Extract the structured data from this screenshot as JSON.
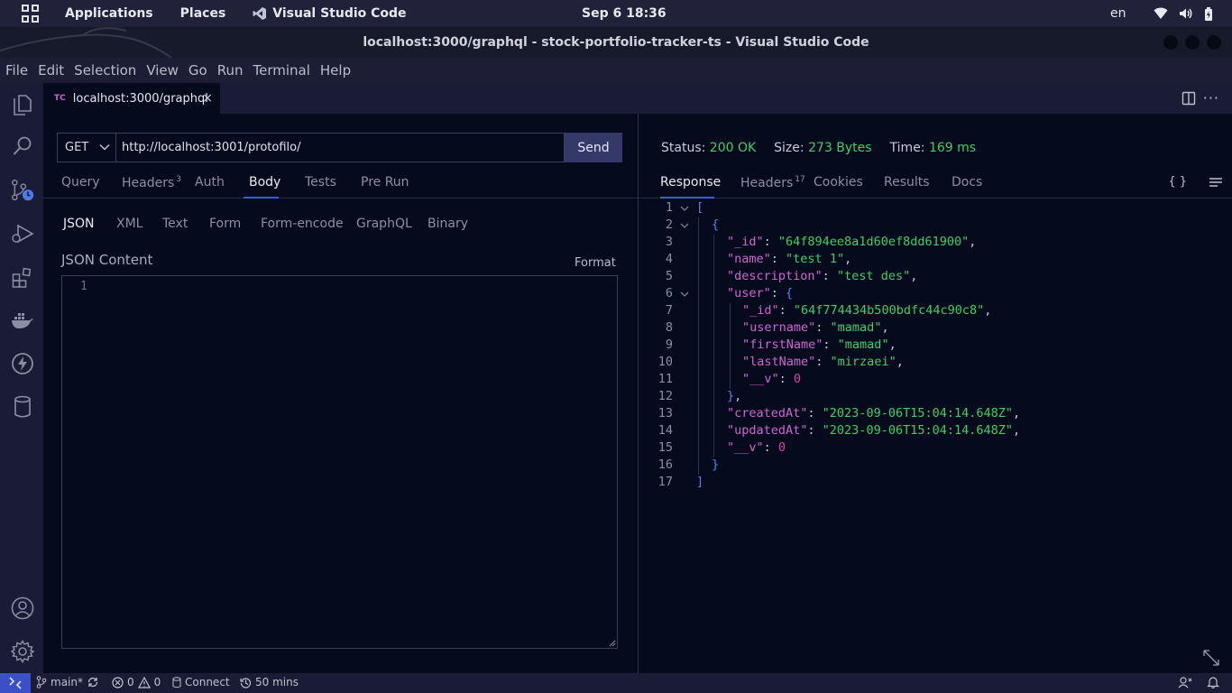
{
  "system_bar": {
    "applications": "Applications",
    "places": "Places",
    "active_app": "Visual Studio Code",
    "clock": "Sep 6  18:36",
    "language": "en"
  },
  "window": {
    "title": "localhost:3000/graphql - stock-portfolio-tracker-ts - Visual Studio Code"
  },
  "menu": [
    "File",
    "Edit",
    "Selection",
    "View",
    "Go",
    "Run",
    "Terminal",
    "Help"
  ],
  "editor_tab": {
    "badge": "TC",
    "label": "localhost:3000/graphql",
    "close": "×"
  },
  "request": {
    "method": "GET",
    "url": "http://localhost:3001/protofilo/",
    "send_label": "Send",
    "tabs": [
      {
        "label": "Query"
      },
      {
        "label": "Headers",
        "count": "3"
      },
      {
        "label": "Auth"
      },
      {
        "label": "Body",
        "active": true
      },
      {
        "label": "Tests"
      },
      {
        "label": "Pre Run"
      }
    ],
    "body_tabs": [
      "JSON",
      "XML",
      "Text",
      "Form",
      "Form-encode",
      "GraphQL",
      "Binary"
    ],
    "json_heading": "JSON Content",
    "format_label": "Format",
    "editor_line_number": "1"
  },
  "response": {
    "status_label": "Status:",
    "status_value": "200 OK",
    "size_label": "Size:",
    "size_value": "273 Bytes",
    "time_label": "Time:",
    "time_value": "169 ms",
    "tabs": [
      {
        "label": "Response",
        "active": true
      },
      {
        "label": "Headers",
        "count": "17"
      },
      {
        "label": "Cookies"
      },
      {
        "label": "Results"
      },
      {
        "label": "Docs"
      }
    ],
    "braces_label": "{ }",
    "body": [
      {
        "n": "1",
        "depth": 0,
        "fold": true,
        "tokens": [
          [
            "br1",
            "["
          ]
        ]
      },
      {
        "n": "2",
        "depth": 1,
        "fold": true,
        "tokens": [
          [
            "br2",
            "{"
          ]
        ]
      },
      {
        "n": "3",
        "depth": 2,
        "tokens": [
          [
            "key",
            "\"_id\""
          ],
          [
            "punc",
            ": "
          ],
          [
            "str",
            "\"64f894ee8a1d60ef8dd61900\""
          ],
          [
            "punc",
            ","
          ]
        ]
      },
      {
        "n": "4",
        "depth": 2,
        "tokens": [
          [
            "key",
            "\"name\""
          ],
          [
            "punc",
            ": "
          ],
          [
            "str",
            "\"test 1\""
          ],
          [
            "punc",
            ","
          ]
        ]
      },
      {
        "n": "5",
        "depth": 2,
        "tokens": [
          [
            "key",
            "\"description\""
          ],
          [
            "punc",
            ": "
          ],
          [
            "str",
            "\"test des\""
          ],
          [
            "punc",
            ","
          ]
        ]
      },
      {
        "n": "6",
        "depth": 2,
        "fold": true,
        "tokens": [
          [
            "key",
            "\"user\""
          ],
          [
            "punc",
            ": "
          ],
          [
            "br1",
            "{"
          ]
        ]
      },
      {
        "n": "7",
        "depth": 3,
        "tokens": [
          [
            "key",
            "\"_id\""
          ],
          [
            "punc",
            ": "
          ],
          [
            "str",
            "\"64f774434b500bdfc44c90c8\""
          ],
          [
            "punc",
            ","
          ]
        ]
      },
      {
        "n": "8",
        "depth": 3,
        "tokens": [
          [
            "key",
            "\"username\""
          ],
          [
            "punc",
            ": "
          ],
          [
            "str",
            "\"mamad\""
          ],
          [
            "punc",
            ","
          ]
        ]
      },
      {
        "n": "9",
        "depth": 3,
        "tokens": [
          [
            "key",
            "\"firstName\""
          ],
          [
            "punc",
            ": "
          ],
          [
            "str",
            "\"mamad\""
          ],
          [
            "punc",
            ","
          ]
        ]
      },
      {
        "n": "10",
        "depth": 3,
        "tokens": [
          [
            "key",
            "\"lastName\""
          ],
          [
            "punc",
            ": "
          ],
          [
            "str",
            "\"mirzaei\""
          ],
          [
            "punc",
            ","
          ]
        ]
      },
      {
        "n": "11",
        "depth": 3,
        "tokens": [
          [
            "key",
            "\"__v\""
          ],
          [
            "punc",
            ": "
          ],
          [
            "num",
            "0"
          ]
        ]
      },
      {
        "n": "12",
        "depth": 2,
        "tokens": [
          [
            "br1",
            "}"
          ],
          [
            "punc",
            ","
          ]
        ]
      },
      {
        "n": "13",
        "depth": 2,
        "tokens": [
          [
            "key",
            "\"createdAt\""
          ],
          [
            "punc",
            ": "
          ],
          [
            "str",
            "\"2023-09-06T15:04:14.648Z\""
          ],
          [
            "punc",
            ","
          ]
        ]
      },
      {
        "n": "14",
        "depth": 2,
        "tokens": [
          [
            "key",
            "\"updatedAt\""
          ],
          [
            "punc",
            ": "
          ],
          [
            "str",
            "\"2023-09-06T15:04:14.648Z\""
          ],
          [
            "punc",
            ","
          ]
        ]
      },
      {
        "n": "15",
        "depth": 2,
        "tokens": [
          [
            "key",
            "\"__v\""
          ],
          [
            "punc",
            ": "
          ],
          [
            "num",
            "0"
          ]
        ]
      },
      {
        "n": "16",
        "depth": 1,
        "tokens": [
          [
            "br2",
            "}"
          ]
        ]
      },
      {
        "n": "17",
        "depth": 0,
        "tokens": [
          [
            "br1",
            "]"
          ]
        ]
      }
    ]
  },
  "status_bar": {
    "branch": "main*",
    "errors": "0",
    "warnings": "0",
    "connect": "Connect",
    "timer": "50 mins"
  },
  "colors": {
    "accent": "#3f5bd6",
    "status_ok": "#3fcf66",
    "json_key": "#cf67cf",
    "json_number": "#e040a0",
    "background": "#050a1c",
    "sidebar": "#1a1b34"
  }
}
